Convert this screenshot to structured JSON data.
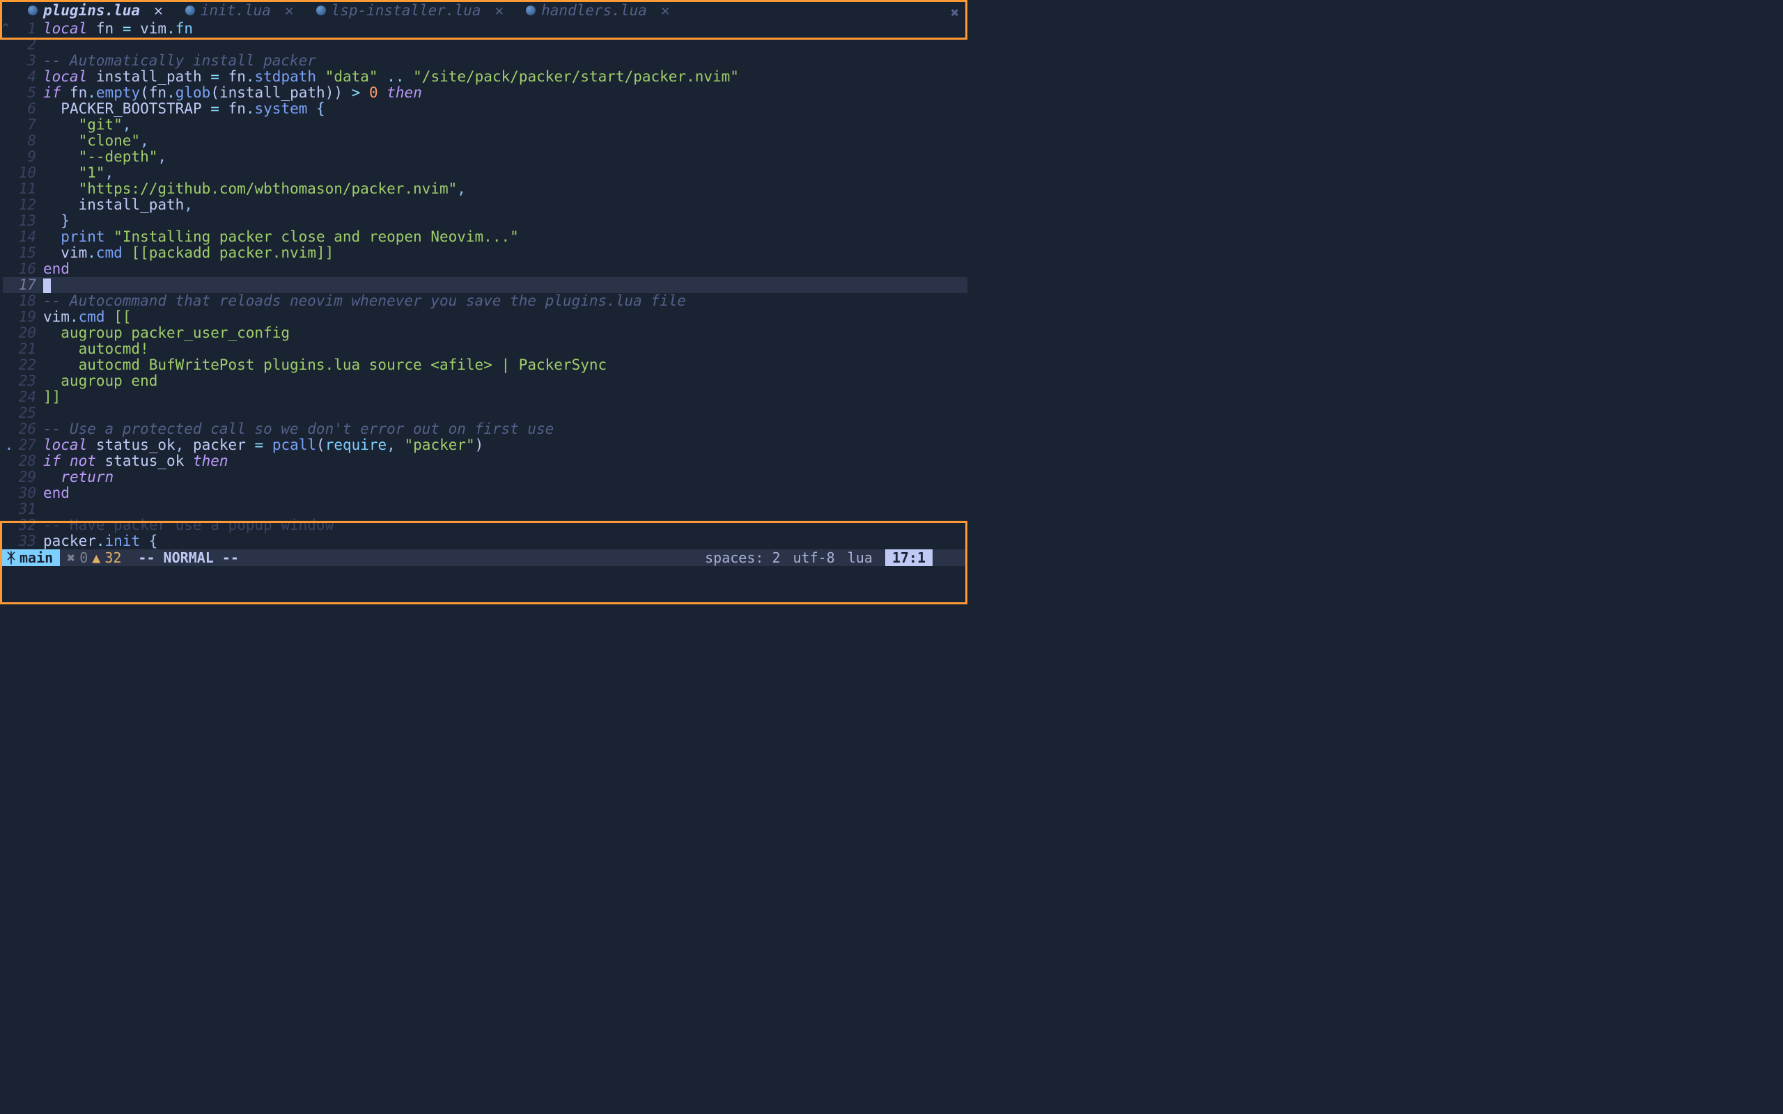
{
  "tabs": [
    {
      "label": "plugins.lua",
      "active": true
    },
    {
      "label": "init.lua",
      "active": false
    },
    {
      "label": "lsp-installer.lua",
      "active": false
    },
    {
      "label": "handlers.lua",
      "active": false
    }
  ],
  "code_lines": [
    {
      "n": 1,
      "sign": "",
      "html": "<span class='kw'>local</span> <span class='ident'>fn</span> <span class='op'>=</span> <span class='ident'>vim</span><span class='op'>.</span><span class='field'>fn</span>"
    },
    {
      "n": 2,
      "sign": "",
      "html": ""
    },
    {
      "n": 3,
      "sign": "",
      "html": "<span class='comment'>-- Automatically install packer</span>"
    },
    {
      "n": 4,
      "sign": "",
      "html": "<span class='kw'>local</span> <span class='ident'>install_path</span> <span class='op'>=</span> <span class='ident'>fn</span><span class='op'>.</span><span class='fn'>stdpath</span> <span class='str'>\"data\"</span> <span class='op'>..</span> <span class='str'>\"/site/pack/packer/start/packer.nvim\"</span>"
    },
    {
      "n": 5,
      "sign": "",
      "html": "<span class='kw'>if</span> <span class='ident'>fn</span><span class='op'>.</span><span class='fn'>empty</span><span class='paren'>(</span><span class='ident'>fn</span><span class='op'>.</span><span class='fn'>glob</span><span class='paren'>(</span><span class='ident'>install_path</span><span class='paren'>))</span> <span class='op'>&gt;</span> <span class='num'>0</span> <span class='kw'>then</span>"
    },
    {
      "n": 6,
      "sign": "",
      "html": "  <span class='const'>PACKER_BOOTSTRAP</span> <span class='op'>=</span> <span class='ident'>fn</span><span class='op'>.</span><span class='fn'>system</span> <span class='punct'>{</span>"
    },
    {
      "n": 7,
      "sign": "",
      "html": "    <span class='str'>\"git\"</span><span class='punct'>,</span>"
    },
    {
      "n": 8,
      "sign": "",
      "html": "    <span class='str'>\"clone\"</span><span class='punct'>,</span>"
    },
    {
      "n": 9,
      "sign": "",
      "html": "    <span class='str'>\"--depth\"</span><span class='punct'>,</span>"
    },
    {
      "n": 10,
      "sign": "",
      "html": "    <span class='str'>\"1\"</span><span class='punct'>,</span>"
    },
    {
      "n": 11,
      "sign": "",
      "html": "    <span class='str'>\"https://github.com/wbthomason/packer.nvim\"</span><span class='punct'>,</span>"
    },
    {
      "n": 12,
      "sign": "",
      "html": "    <span class='ident'>install_path</span><span class='punct'>,</span>"
    },
    {
      "n": 13,
      "sign": "",
      "html": "  <span class='punct'>}</span>"
    },
    {
      "n": 14,
      "sign": "",
      "html": "  <span class='fn'>print</span> <span class='str'>\"Installing packer close and reopen Neovim...\"</span>"
    },
    {
      "n": 15,
      "sign": "",
      "html": "  <span class='ident'>vim</span><span class='op'>.</span><span class='fn'>cmd</span> <span class='str'>[[packadd packer.nvim]]</span>"
    },
    {
      "n": 16,
      "sign": "",
      "html": "<span class='kw2'>end</span>"
    },
    {
      "n": 17,
      "sign": "",
      "cursor": true,
      "html": "<span class='cursor-block'></span>"
    },
    {
      "n": 18,
      "sign": "",
      "html": "<span class='comment'>-- Autocommand that reloads neovim whenever you save the plugins.lua file</span>"
    },
    {
      "n": 19,
      "sign": "",
      "html": "<span class='ident'>vim</span><span class='op'>.</span><span class='fn'>cmd</span> <span class='str'>[[</span>"
    },
    {
      "n": 20,
      "sign": "",
      "html": "<span class='str'>  augroup packer_user_config</span>"
    },
    {
      "n": 21,
      "sign": "",
      "html": "<span class='str'>    autocmd!</span>"
    },
    {
      "n": 22,
      "sign": "",
      "html": "<span class='str'>    autocmd BufWritePost plugins.lua source &lt;afile&gt; | PackerSync</span>"
    },
    {
      "n": 23,
      "sign": "",
      "html": "<span class='str'>  augroup end</span>"
    },
    {
      "n": 24,
      "sign": "",
      "html": "<span class='str'>]]</span>"
    },
    {
      "n": 25,
      "sign": "",
      "html": ""
    },
    {
      "n": 26,
      "sign": "",
      "html": "<span class='comment'>-- Use a protected call so we don't error out on first use</span>"
    },
    {
      "n": 27,
      "sign": ".",
      "html": "<span class='kw'>local</span> <span class='ident'>status_ok</span><span class='punct'>,</span> <span class='ident'>packer</span> <span class='op'>=</span> <span class='fn'>pcall</span><span class='paren'>(</span><span class='builtin'>require</span><span class='punct'>,</span> <span class='str'>\"packer\"</span><span class='paren'>)</span>"
    },
    {
      "n": 28,
      "sign": "",
      "html": "<span class='kw'>if</span> <span class='kw'>not</span> <span class='ident'>status_ok</span> <span class='kw'>then</span>"
    },
    {
      "n": 29,
      "sign": "",
      "html": "  <span class='kw'>return</span>"
    },
    {
      "n": 30,
      "sign": "",
      "html": "<span class='kw2'>end</span>"
    },
    {
      "n": 31,
      "sign": "",
      "html": ""
    },
    {
      "n": 32,
      "sign": "",
      "html": "<span class='dimmed'>-- Have packer use a popup window</span>"
    },
    {
      "n": 33,
      "sign": "",
      "html": "<span class='ident'>packer</span><span class='op'>.</span><span class='fn'>init</span> <span class='punct'>{</span>"
    }
  ],
  "status": {
    "branch_icon": "ᛡ",
    "branch": "main",
    "error_icon": "✖",
    "errors": "0",
    "warn_icon": "▲",
    "warnings": "32",
    "mode": "-- NORMAL --",
    "spaces": "spaces: 2",
    "encoding": "utf-8",
    "filetype": "lua",
    "position": "17:1"
  }
}
